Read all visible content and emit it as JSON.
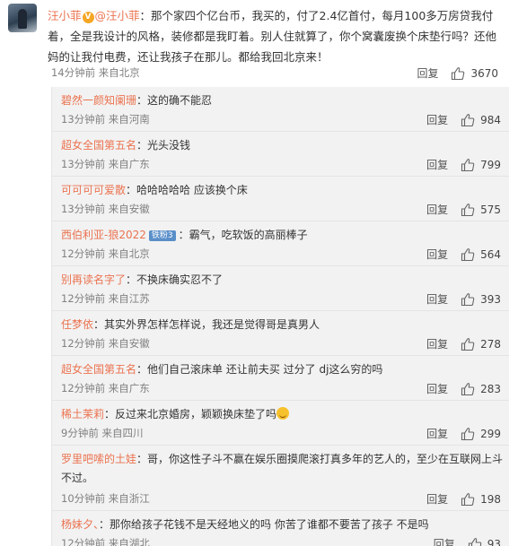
{
  "post": {
    "author": "汪小菲",
    "mention": "@汪小菲",
    "text_part1": "：那个家四个亿台币，我买的，付了2.4亿首付，每月100多万房贷我付着，全是我设计的风格，装修都是我盯着。别人住就算了，你个窝囊废换个床垫行吗？还他妈的让我付电费，还让我孩子在那儿。都给我回北京来！",
    "time": "14分钟前",
    "location": "来自北京",
    "reply_label": "回复",
    "likes": "3670"
  },
  "comments": [
    {
      "name": "碧然一颜知阑珊",
      "text": "：这的确不能忍",
      "time": "13分钟前",
      "location": "来自河南",
      "reply": "回复",
      "likes": "984"
    },
    {
      "name": "超女全国第五名",
      "text": "：光头没钱",
      "time": "13分钟前",
      "location": "来自广东",
      "reply": "回复",
      "likes": "799"
    },
    {
      "name": "可可可可爱散",
      "text": "：哈哈哈哈哈 应该换个床",
      "time": "13分钟前",
      "location": "来自安徽",
      "reply": "回复",
      "likes": "575"
    },
    {
      "name": "西伯利亚-狼2022",
      "tag": "铁粉3",
      "text": "：霸气，吃软饭的高丽棒子",
      "time": "12分钟前",
      "location": "来自北京",
      "reply": "回复",
      "likes": "564"
    },
    {
      "name": "别再读名字了",
      "text": "：不换床确实忍不了",
      "time": "12分钟前",
      "location": "来自江苏",
      "reply": "回复",
      "likes": "393"
    },
    {
      "name": "任梦依",
      "text": "：其实外界怎样怎样说，我还是觉得哥是真男人",
      "time": "12分钟前",
      "location": "来自安徽",
      "reply": "回复",
      "likes": "278"
    },
    {
      "name": "超女全国第五名",
      "text": "：他们自己滚床单 还让前夫买 过分了 dj这么穷的吗",
      "time": "12分钟前",
      "location": "来自广东",
      "reply": "回复",
      "likes": "283"
    },
    {
      "name": "稀土茉莉",
      "text": "：反过来北京婚房，颖颖换床垫了吗",
      "time": "9分钟前",
      "location": "来自四川",
      "reply": "回复",
      "likes": "299"
    },
    {
      "name": "罗里吧嗦的土娃",
      "text": "：哥，你这性子斗不赢在娱乐圈摸爬滚打真多年的艺人的，至少在互联网上斗",
      "text2": "不过。",
      "time": "10分钟前",
      "location": "来自浙江",
      "reply": "回复",
      "likes": "198"
    },
    {
      "name": "杨妹夕、",
      "text": "：那你给孩子花钱不是天经地义的吗 你苦了谁都不要苦了孩子 不是吗",
      "time": "12分钟前",
      "location": "来自湖北",
      "reply": "回复",
      "likes": "93"
    }
  ],
  "colors": {
    "username": "#eb7350",
    "meta": "#808080",
    "subbg": "#f2f2f2"
  },
  "icons": {
    "verified": "verified-badge-icon",
    "like": "thumbs-up-icon"
  }
}
